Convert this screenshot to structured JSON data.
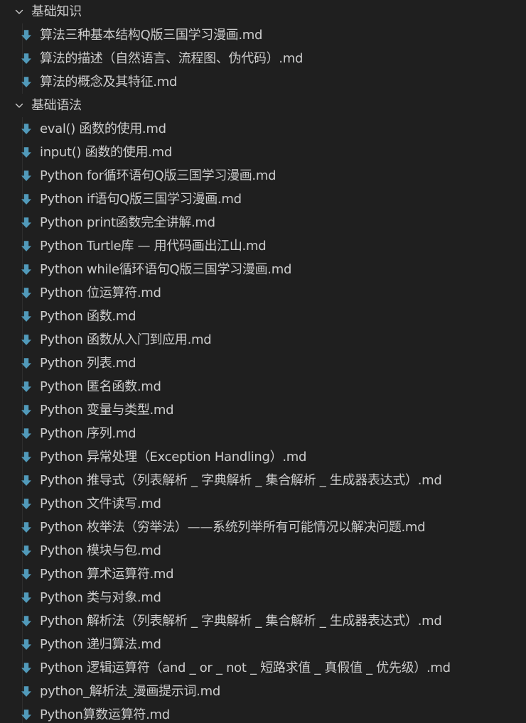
{
  "explorer": {
    "icon_color": "#519aba",
    "folders": [
      {
        "name": "基础知识",
        "expanded": true,
        "files": [
          "算法三种基本结构Q版三国学习漫画.md",
          "算法的描述（自然语言、流程图、伪代码）.md",
          "算法的概念及其特征.md"
        ]
      },
      {
        "name": "基础语法",
        "expanded": true,
        "files": [
          "eval() 函数的使用.md",
          "input() 函数的使用.md",
          "Python for循环语句Q版三国学习漫画.md",
          "Python if语句Q版三国学习漫画.md",
          "Python print函数完全讲解.md",
          "Python Turtle库 — 用代码画出江山.md",
          "Python while循环语句Q版三国学习漫画.md",
          "Python 位运算符.md",
          "Python 函数.md",
          "Python 函数从入门到应用.md",
          "Python 列表.md",
          "Python 匿名函数.md",
          "Python 变量与类型.md",
          "Python 序列.md",
          "Python 异常处理（Exception Handling）.md",
          "Python 推导式（列表解析 _ 字典解析 _ 集合解析 _ 生成器表达式）.md",
          "Python 文件读写.md",
          "Python 枚举法（穷举法）——系统列举所有可能情况以解决问题.md",
          "Python 模块与包.md",
          "Python 算术运算符.md",
          "Python 类与对象.md",
          "Python 解析法（列表解析 _ 字典解析 _ 集合解析 _ 生成器表达式）.md",
          "Python 递归算法.md",
          "Python 逻辑运算符（and _ or _ not _ 短路求值 _ 真假值 _ 优先级）.md",
          "python_解析法_漫画提示词.md",
          "Python算数运算符.md"
        ]
      }
    ]
  }
}
